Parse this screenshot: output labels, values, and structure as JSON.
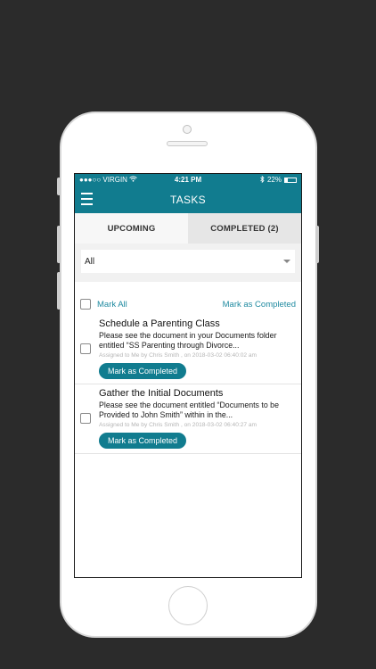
{
  "status_bar": {
    "carrier": "●●●○○ VIRGIN",
    "time": "4:21 PM",
    "battery": "22%"
  },
  "nav": {
    "title": "TASKS"
  },
  "tabs": [
    {
      "label": "UPCOMING"
    },
    {
      "label": "COMPLETED (2)"
    }
  ],
  "filter": {
    "selected": "All"
  },
  "list_actions": {
    "mark_all": "Mark All",
    "mark_completed": "Mark as Completed"
  },
  "tasks": [
    {
      "title": "Schedule a Parenting Class",
      "description": "Please see the document in your Documents folder entitled “SS Parenting through Divorce...",
      "meta": "Assigned to Me by Chris Smith , on 2018-03-02 06:40:02 am",
      "button": "Mark as Completed"
    },
    {
      "title": "Gather the Initial Documents",
      "description": "Please see the document entitled “Documents to be Provided to John Smith” within in the...",
      "meta": "Assigned to Me by Chris Smith , on 2018-03-02 06:40:27 am",
      "button": "Mark as Completed"
    }
  ],
  "colors": {
    "accent": "#117c8f",
    "link": "#1f8aa0",
    "background": "#2b2b2b"
  }
}
